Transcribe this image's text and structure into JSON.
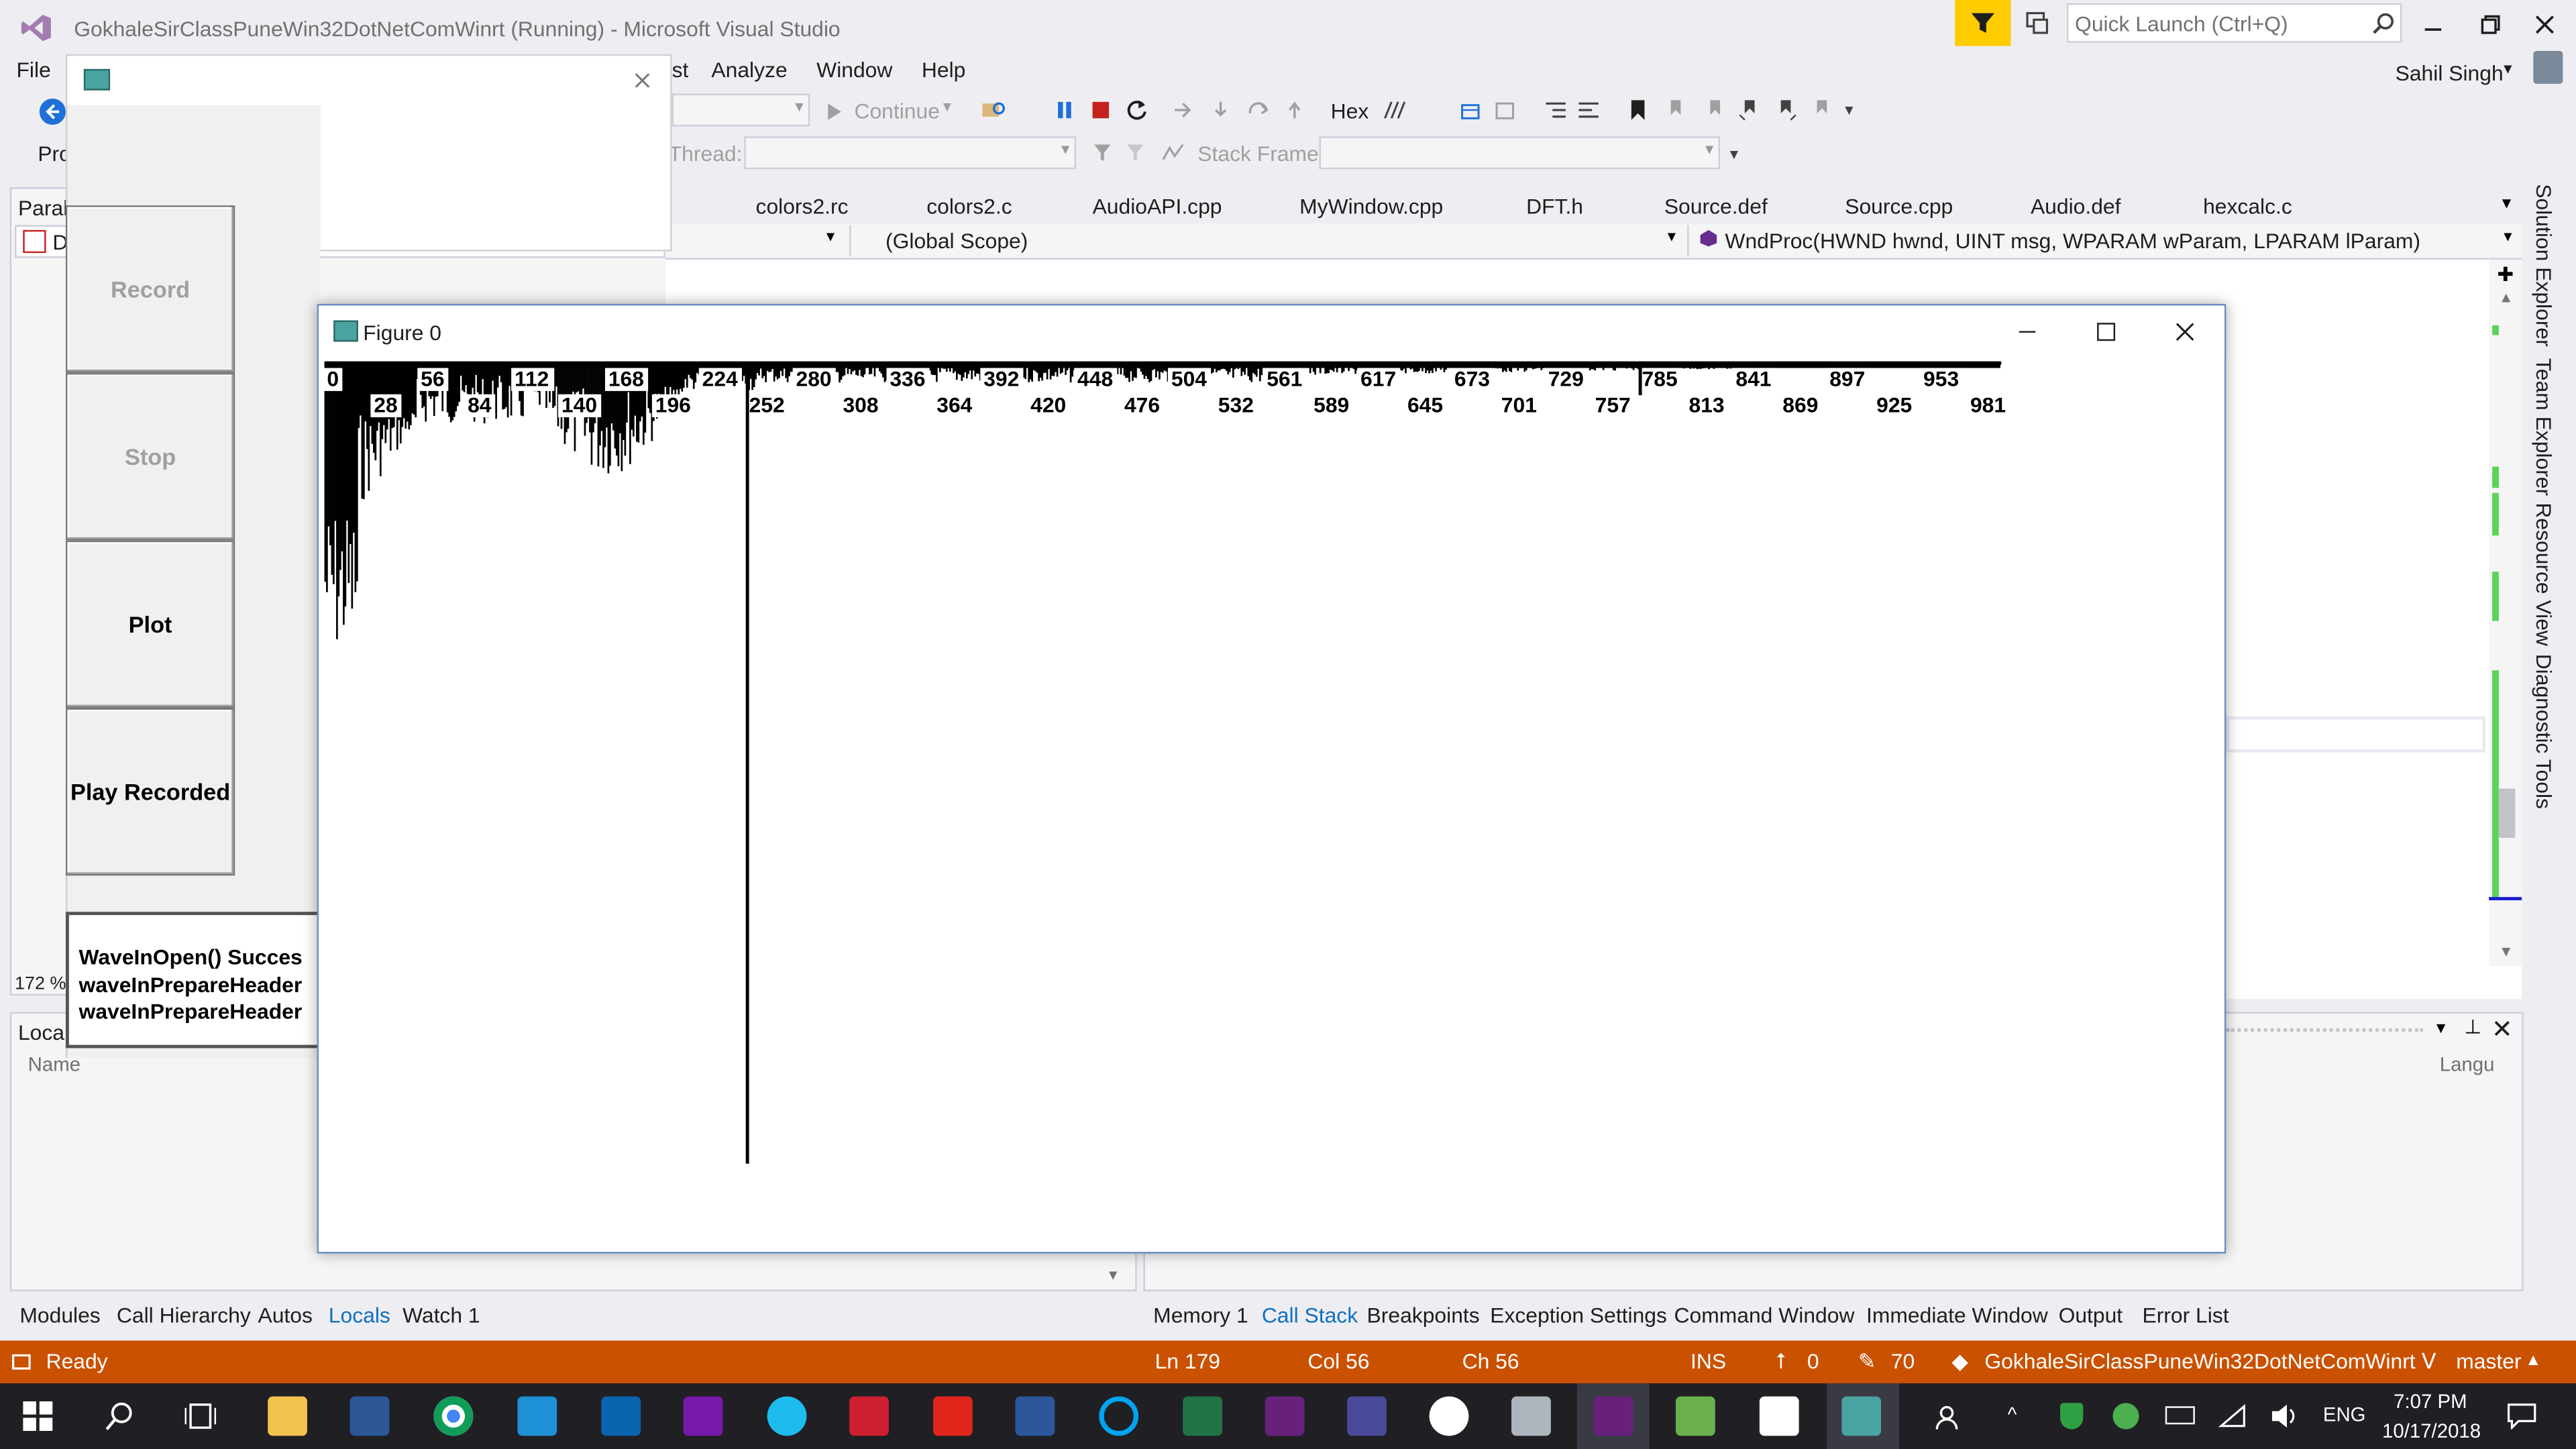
{
  "vs": {
    "title": "GokhaleSirClassPuneWin32DotNetComWinrt (Running) - Microsoft Visual Studio",
    "quick_launch_placeholder": "Quick Launch (Ctrl+Q)",
    "user": "Sahil Singh",
    "menu": [
      "File",
      "st",
      "Analyze",
      "Window",
      "Help"
    ],
    "toolbar": {
      "continue_label": "Continue",
      "hex_label": "Hex",
      "thread_label": "Thread:",
      "stack_frame_label": "Stack Frame:",
      "pro_label": "Pro"
    },
    "left_panel": {
      "title": "Parall",
      "zoom": "172 %",
      "item": "DF"
    },
    "doc_tabs": [
      "colors2.rc",
      "colors2.c",
      "AudioAPI.cpp",
      "MyWindow.cpp",
      "DFT.h",
      "Source.def",
      "Source.cpp",
      "Audio.def",
      "hexcalc.c"
    ],
    "nav": {
      "scope": "(Global Scope)",
      "member": "WndProc(HWND hwnd, UINT msg, WPARAM wParam, LPARAM lParam)"
    },
    "locals": {
      "title": "Locals",
      "col_name": "Name",
      "col_lang": "Langu"
    },
    "bottom_tabs_left": [
      "Modules",
      "Call Hierarchy",
      "Autos",
      "Locals",
      "Watch 1"
    ],
    "bottom_tabs_right": [
      "Memory 1",
      "Call Stack",
      "Breakpoints",
      "Exception Settings",
      "Command Window",
      "Immediate Window",
      "Output",
      "Error List"
    ],
    "right_rail": [
      "Solution Explorer",
      "Team Explorer",
      "Resource View",
      "Diagnostic Tools"
    ],
    "status": {
      "ready": "Ready",
      "ln": "Ln 179",
      "col": "Col 56",
      "ch": "Ch 56",
      "ins": "INS",
      "up": "0",
      "pencil": "70",
      "repo": "GokhaleSirClassPuneWin32DotNetComWinrt",
      "branch": "master"
    }
  },
  "recorder": {
    "buttons": [
      "Record",
      "Stop",
      "Plot",
      "Play Recorded"
    ],
    "button_enabled": [
      false,
      false,
      true,
      true
    ],
    "log": [
      "WaveInOpen() Succes",
      "waveInPrepareHeader",
      "waveInPrepareHeader"
    ]
  },
  "figure": {
    "title": "Figure 0",
    "labels_row1": [
      "0",
      "56",
      "112",
      "168",
      "224",
      "280",
      "336",
      "392",
      "448",
      "504",
      "561",
      "617",
      "673",
      "729",
      "785",
      "841",
      "897",
      "953"
    ],
    "labels_row2": [
      "28",
      "84",
      "140",
      "196",
      "252",
      "308",
      "364",
      "420",
      "476",
      "532",
      "589",
      "645",
      "701",
      "757",
      "813",
      "869",
      "925",
      "981"
    ],
    "spikes": [
      {
        "index": 252,
        "depth": 0.95
      },
      {
        "index": 785,
        "depth": 0.04
      }
    ]
  },
  "taskbar": {
    "time": "7:07 PM",
    "date": "10/17/2018",
    "lang": "ENG"
  }
}
